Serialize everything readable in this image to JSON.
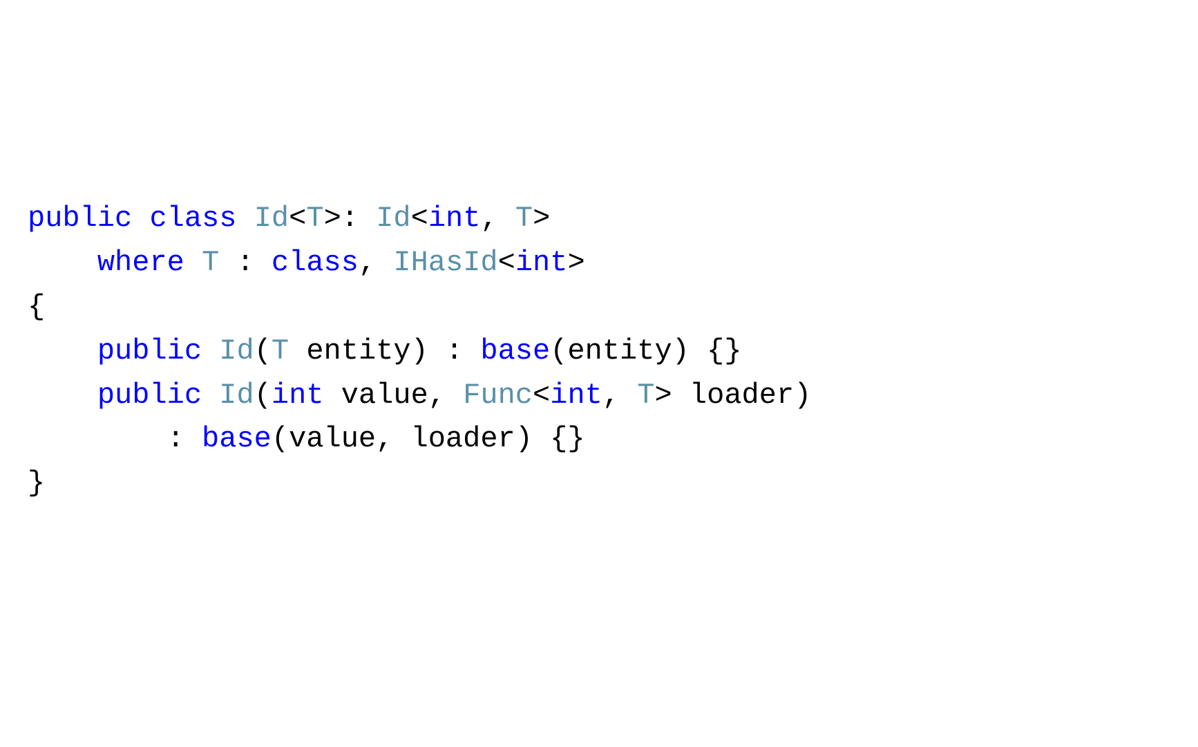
{
  "code": {
    "line1": {
      "kw_public": "public",
      "kw_class": "class",
      "type_id1": "Id",
      "angle1": "<",
      "type_t1": "T",
      "angle2": ">",
      "colon": ": ",
      "type_id2": "Id",
      "angle3": "<",
      "kw_int1": "int",
      "comma1": ", ",
      "type_t2": "T",
      "angle4": ">"
    },
    "line2": {
      "indent": "    ",
      "kw_where": "where",
      "sp1": " ",
      "type_t": "T",
      "colon": " : ",
      "kw_class": "class",
      "comma": ", ",
      "type_ihasid": "IHasId",
      "angle1": "<",
      "kw_int": "int",
      "angle2": ">"
    },
    "line3": {
      "brace": "{"
    },
    "line4": {
      "indent": "    ",
      "kw_public": "public",
      "sp1": " ",
      "type_id": "Id",
      "paren1": "(",
      "type_t": "T",
      "param": " entity) : ",
      "kw_base": "base",
      "rest": "(entity) {}"
    },
    "line5": {
      "blank": ""
    },
    "line6": {
      "indent": "    ",
      "kw_public": "public",
      "sp1": " ",
      "type_id": "Id",
      "paren1": "(",
      "kw_int": "int",
      "param1": " value, ",
      "type_func": "Func",
      "angle1": "<",
      "kw_int2": "int",
      "comma": ", ",
      "type_t": "T",
      "angle2": ">",
      "param2": " loader)"
    },
    "line7": {
      "indent": "        : ",
      "kw_base": "base",
      "rest": "(value, loader) {}"
    },
    "line8": {
      "brace": "}"
    }
  }
}
